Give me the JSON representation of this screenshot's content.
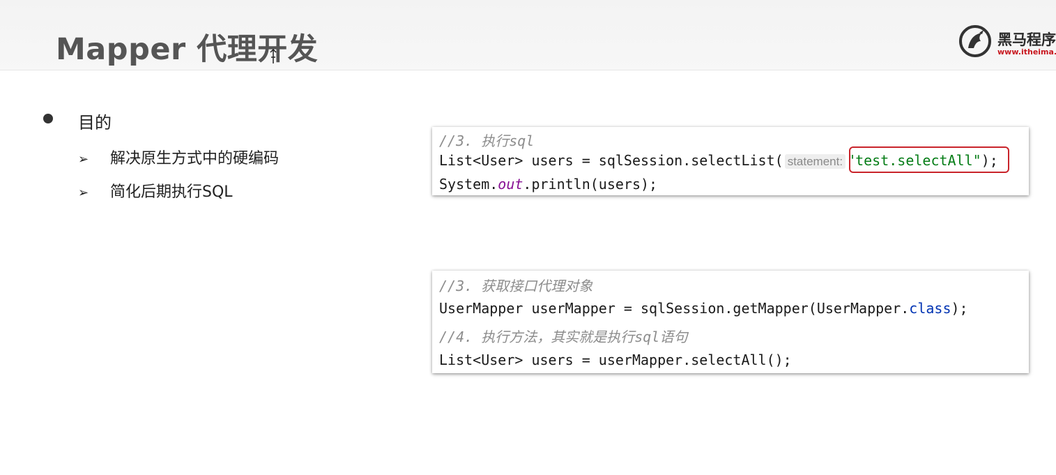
{
  "slide": {
    "title": "Mapper 代理开发"
  },
  "logo": {
    "name": "黑马程序",
    "url": "www.itheima.c"
  },
  "content": {
    "bullet": "目的",
    "sub_items": [
      "解决原生方式中的硬编码",
      "简化后期执行SQL"
    ]
  },
  "code1": {
    "comment": "//3. 执行sql",
    "line2_a": "List<User> users = sqlSession.selectList(",
    "param_hint": "statement:",
    "string_arg": "\"test.selectAll\"",
    "line2_end": ");",
    "line3_a": "System.",
    "line3_field": "out",
    "line3_b": ".println(users);"
  },
  "code2": {
    "comment1": "//3. 获取接口代理对象",
    "line2_a": "UserMapper userMapper = sqlSession.getMapper(UserMapper.",
    "line2_kw": "class",
    "line2_end": ");",
    "comment2": "//4. 执行方法，其实就是执行sql语句",
    "line4": "List<User> users = userMapper.selectAll();"
  },
  "colors": {
    "highlight_border": "#c9242b",
    "string": "#067d17",
    "keyword": "#0033b3",
    "static_field": "#871094",
    "comment": "#8c8c8c"
  }
}
